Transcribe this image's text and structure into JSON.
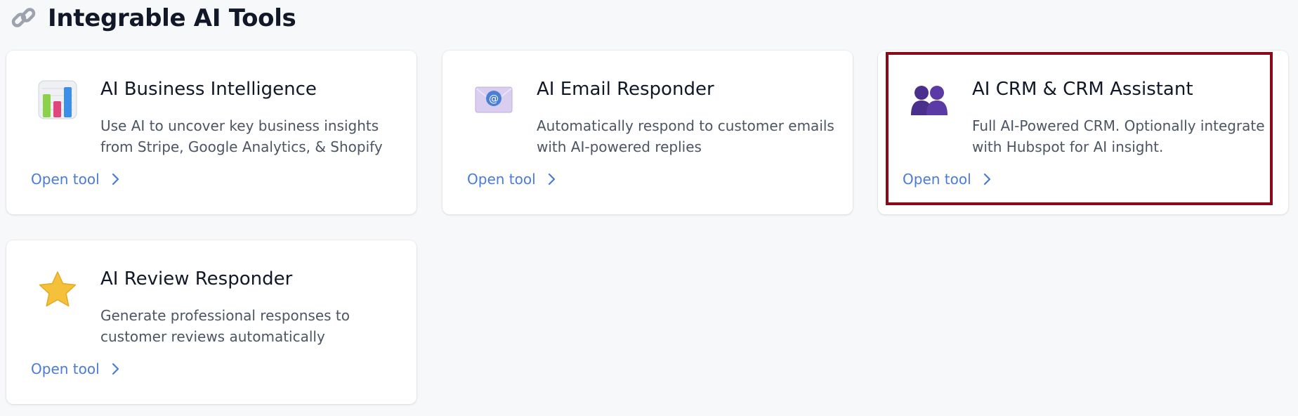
{
  "header": {
    "title": "Integrable AI Tools",
    "icon": "link-icon"
  },
  "tools": [
    {
      "title": "AI Business Intelligence",
      "description": "Use AI to uncover key business insights from Stripe, Google Analytics, & Shopify",
      "link_label": "Open tool",
      "icon": "bar-chart-icon",
      "selected": false
    },
    {
      "title": "AI Email Responder",
      "description": "Automatically respond to customer emails with AI-powered replies",
      "link_label": "Open tool",
      "icon": "email-icon",
      "selected": false
    },
    {
      "title": "AI CRM & CRM Assistant",
      "description": "Full AI-Powered CRM. Optionally integrate with Hubspot for AI insight.",
      "link_label": "Open tool",
      "icon": "people-icon",
      "selected": true
    },
    {
      "title": "AI Review Responder",
      "description": "Generate professional responses to customer reviews automatically",
      "link_label": "Open tool",
      "icon": "star-icon",
      "selected": false
    }
  ],
  "colors": {
    "accent": "#4b7bd8",
    "selection_outline": "#8b0a1a",
    "background": "#f7f8fa"
  }
}
